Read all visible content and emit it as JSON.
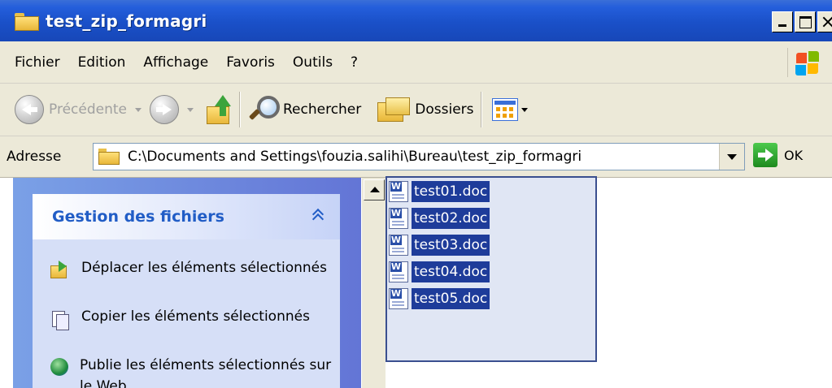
{
  "window": {
    "title": "test_zip_formagri"
  },
  "menu": {
    "items": [
      "Fichier",
      "Edition",
      "Affichage",
      "Favoris",
      "Outils",
      "?"
    ]
  },
  "toolbar": {
    "back_label": "Précédente",
    "search_label": "Rechercher",
    "folders_label": "Dossiers"
  },
  "address": {
    "label": "Adresse",
    "path": "C:\\Documents and Settings\\fouzia.salihi\\Bureau\\test_zip_formagri",
    "go_label": "OK"
  },
  "tasks": {
    "title": "Gestion des fichiers",
    "items": [
      {
        "label": "Déplacer les éléments sélectionnés",
        "icon": "move-icon"
      },
      {
        "label": "Copier les éléments sélectionnés",
        "icon": "copy-icon"
      },
      {
        "label": "Publie les éléments sélectionnés sur le Web",
        "icon": "web-icon"
      }
    ]
  },
  "files": {
    "items": [
      "test01.doc",
      "test02.doc",
      "test03.doc",
      "test04.doc",
      "test05.doc"
    ]
  },
  "colors": {
    "titlebar": "#245edb",
    "selection": "#1e3c9a",
    "task_title": "#215dc6"
  }
}
